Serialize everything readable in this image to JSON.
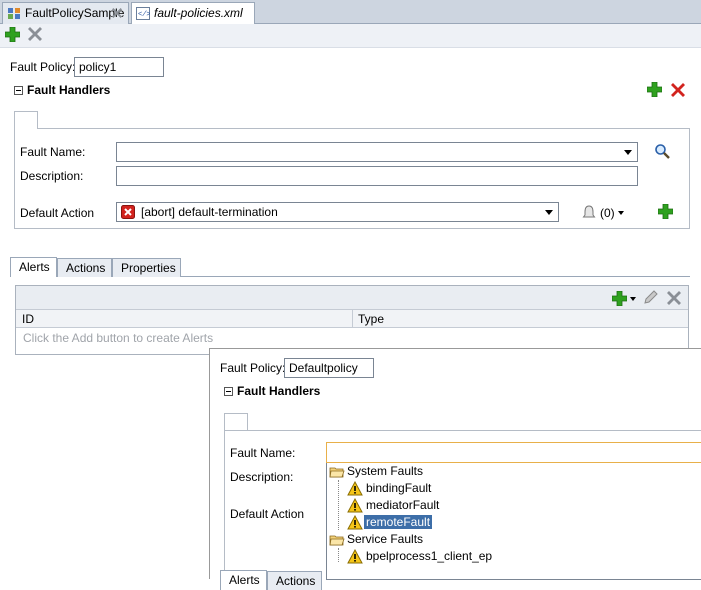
{
  "tabs": [
    {
      "label": "FaultPolicySample",
      "active": false
    },
    {
      "label": "fault-policies.xml",
      "active": true
    }
  ],
  "toolbar": {
    "add_icon": "plus-icon",
    "remove_icon": "x-icon"
  },
  "main": {
    "fault_policy_label": "Fault Policy:",
    "fault_policy_value": "policy1",
    "fault_handlers_label": "Fault Handlers",
    "fault_name_label": "Fault Name:",
    "fault_name_value": "",
    "description_label": "Description:",
    "description_value": "",
    "default_action_label": "Default Action",
    "default_action_value": "[abort] default-termination",
    "alert_count": "(0)",
    "bottom_tabs": [
      "Alerts",
      "Actions",
      "Properties"
    ],
    "table": {
      "columns": [
        "ID",
        "Type"
      ],
      "empty_text": "Click the Add button to create Alerts"
    }
  },
  "overlay": {
    "fault_policy_label": "Fault Policy:",
    "fault_policy_value": "Defaultpolicy",
    "fault_handlers_label": "Fault Handlers",
    "fault_name_label": "Fault Name:",
    "description_label": "Description:",
    "default_action_label": "Default Action",
    "tree": [
      {
        "label": "System Faults",
        "kind": "folder",
        "level": 0
      },
      {
        "label": "bindingFault",
        "kind": "fault",
        "level": 1
      },
      {
        "label": "mediatorFault",
        "kind": "fault",
        "level": 1
      },
      {
        "label": "remoteFault",
        "kind": "fault",
        "level": 1,
        "selected": true
      },
      {
        "label": "Service Faults",
        "kind": "folder",
        "level": 0
      },
      {
        "label": "bpelprocess1_client_ep",
        "kind": "fault",
        "level": 1
      }
    ],
    "bottom_tabs": [
      "Alerts",
      "Actions"
    ]
  },
  "colors": {
    "accent_green": "#2e9b1f",
    "accent_red": "#d2231e",
    "selection": "#3d6ea8"
  }
}
